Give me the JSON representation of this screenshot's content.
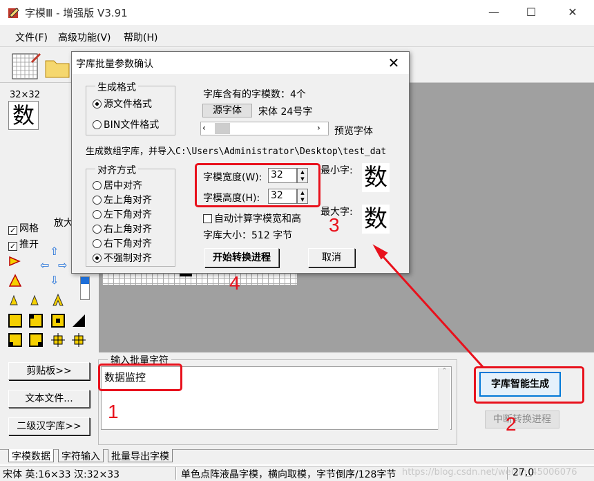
{
  "window": {
    "title": "字模Ⅲ - 增强版 V3.91",
    "minimize": "—",
    "maximize": "☐",
    "close": "✕"
  },
  "menu": {
    "file": "文件(F)",
    "advanced": "高级功能(V)",
    "help": "帮助(H)"
  },
  "left": {
    "preview_size": "32×32",
    "preview_char": "数",
    "zoom_label": "放大",
    "grid_label": "网格",
    "push_label": "推开",
    "grid_checked": true,
    "push_checked": true
  },
  "bottom": {
    "clipboard_btn": "剪贴板>>",
    "textfile_btn": "文本文件...",
    "secondary_btn": "二级汉字库>>",
    "batch_legend": "输入批量字符",
    "batch_text": "数据监控",
    "smart_gen_btn": "字库智能生成",
    "interrupt_btn": "中断转换进程"
  },
  "tabs": [
    "字模数据",
    "字符输入",
    "批量导出字模"
  ],
  "status": {
    "font_info": "宋体 英:16×33 汉:32×33",
    "mode_info": "单色点阵液晶字模，横向取模，字节倒序/128字节",
    "watermark": "https://blog.csdn.net/weixin_45006076",
    "position": "27,0"
  },
  "dialog": {
    "title": "字库批量参数确认",
    "close": "✕",
    "format_legend": "生成格式",
    "format_options": [
      {
        "label": "源文件格式",
        "selected": true
      },
      {
        "label": "BIN文件格式",
        "selected": false
      }
    ],
    "char_count": "字库含有的字模数：4个",
    "source_font_btn": "源字体",
    "font_desc": "宋体 24号字",
    "preview_font": "预览字体",
    "path_text": "生成数组字库，并导入C:\\Users\\Administrator\\Desktop\\test_dat",
    "align_legend": "对齐方式",
    "align_options": [
      {
        "label": "居中对齐",
        "selected": false
      },
      {
        "label": "左上角对齐",
        "selected": false
      },
      {
        "label": "左下角对齐",
        "selected": false
      },
      {
        "label": "右上角对齐",
        "selected": false
      },
      {
        "label": "右下角对齐",
        "selected": false
      },
      {
        "label": "不强制对齐",
        "selected": true
      }
    ],
    "width_label": "字模宽度(W):",
    "width_value": "32",
    "height_label": "字模高度(H):",
    "height_value": "32",
    "auto_calc_label": "自动计算字模宽和高",
    "auto_calc_checked": false,
    "lib_size": "字库大小：512 字节",
    "min_char_label": "最小字:",
    "max_char_label": "最大字:",
    "min_char": "数",
    "max_char": "数",
    "start_btn": "开始转换进程",
    "cancel_btn": "取消"
  },
  "annotations": {
    "n1": "1",
    "n2": "2",
    "n3": "3",
    "n4": "4",
    "color": "#e8111c"
  }
}
